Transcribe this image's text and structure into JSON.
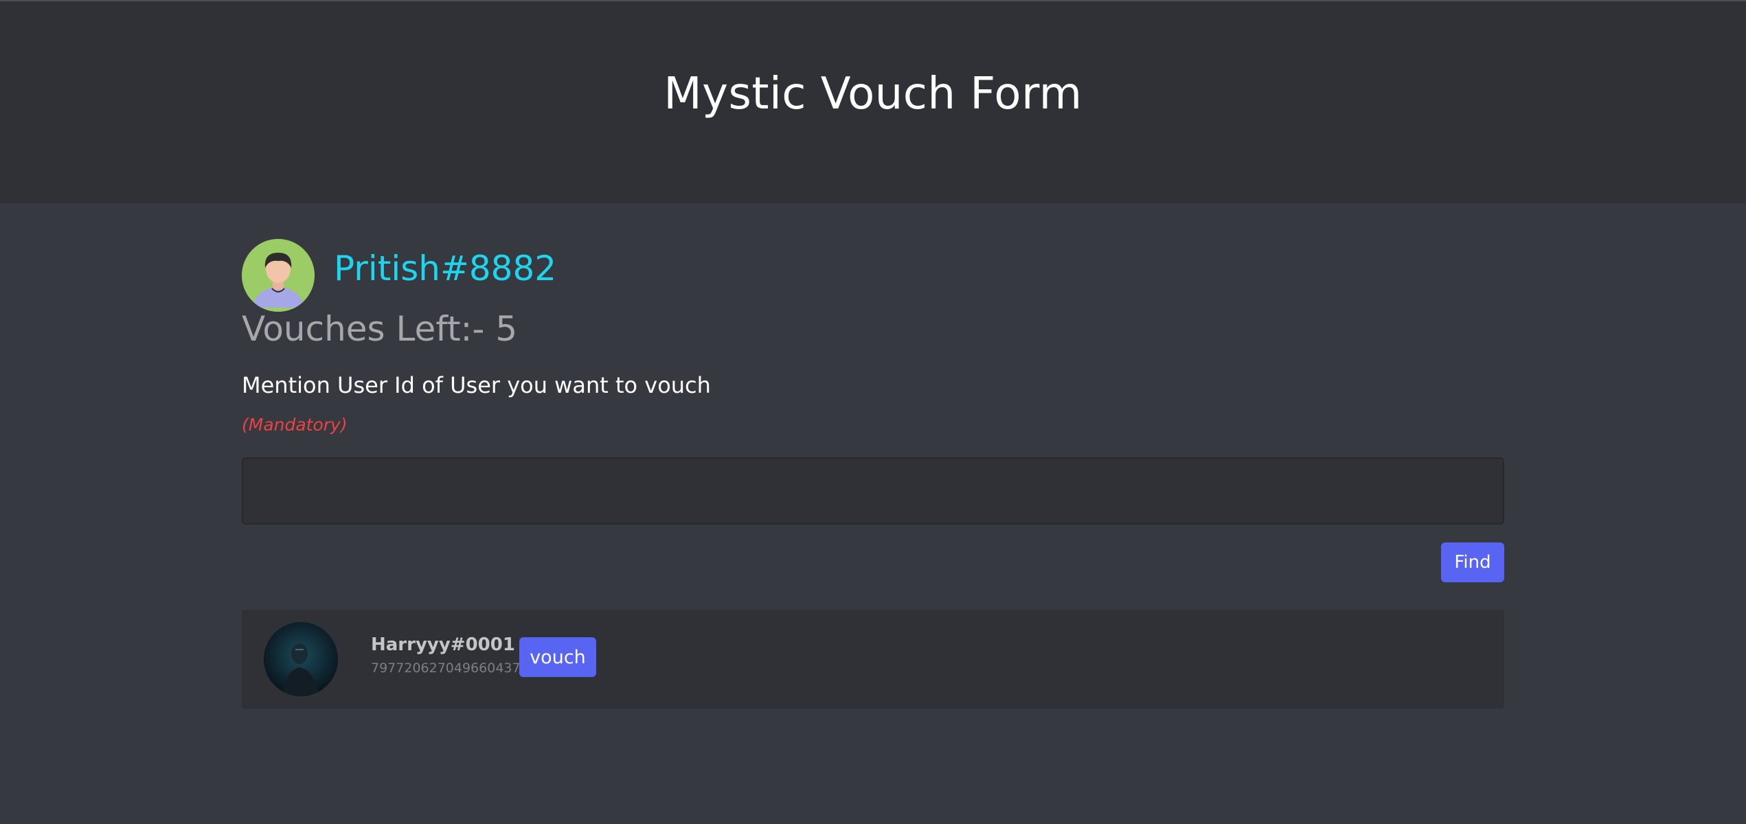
{
  "header": {
    "title": "Mystic Vouch Form"
  },
  "profile": {
    "username": "Pritish#8882",
    "avatar_icon": "user-avatar-icon",
    "vouches_left": "Vouches Left:- 5"
  },
  "form": {
    "mention_label": "Mention User Id of User you want to vouch",
    "mandatory_note": "(Mandatory)",
    "input_value": "",
    "find_label": "Find"
  },
  "result": {
    "name": "Harryyy#0001",
    "user_id": "797720627049660437",
    "vouch_label": "vouch"
  },
  "colors": {
    "background": "#36393f",
    "header": "#2f3136",
    "accent": "#5865f2",
    "username": "#1fd5ee",
    "mandatory": "#ed4245"
  }
}
